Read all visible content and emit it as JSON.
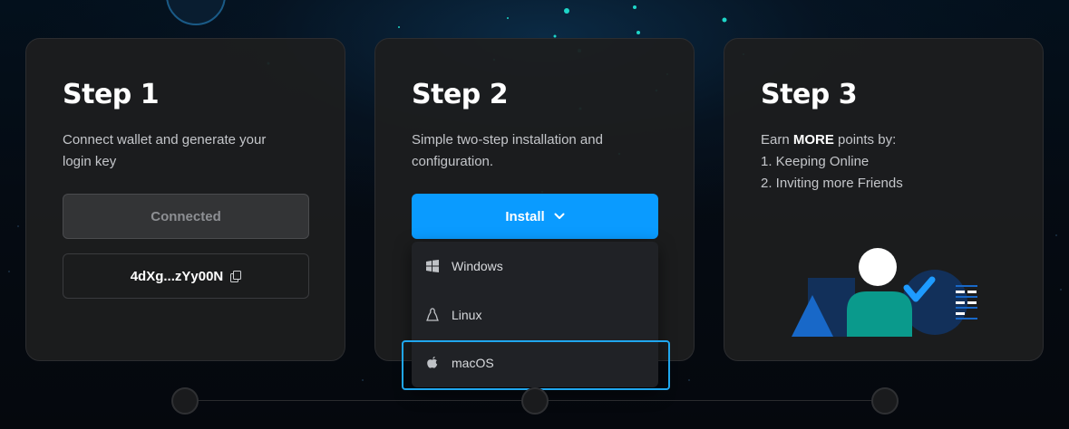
{
  "steps": [
    {
      "title": "Step 1",
      "description": "Connect wallet and generate your login key",
      "connected_label": "Connected",
      "login_key": "4dXg...zYy00N"
    },
    {
      "title": "Step 2",
      "description": "Simple two-step installation and configuration.",
      "install_label": "Install",
      "os_options": [
        {
          "label": "Windows",
          "icon": "windows-icon"
        },
        {
          "label": "Linux",
          "icon": "linux-icon"
        },
        {
          "label": "macOS",
          "icon": "apple-icon"
        }
      ],
      "highlighted_option": "macOS"
    },
    {
      "title": "Step 3",
      "description_prefix": "Earn ",
      "description_emphasis": "MORE",
      "description_suffix": " points by:",
      "list": [
        "1. Keeping Online",
        "2. Inviting more Friends"
      ]
    }
  ],
  "colors": {
    "accent": "#0a9bff",
    "highlight_border": "#20a7ee",
    "card_bg": "#1c1d1f",
    "illustration_navy": "#12305a",
    "illustration_teal": "#0a9a8c",
    "illustration_blue": "#1868c8"
  }
}
